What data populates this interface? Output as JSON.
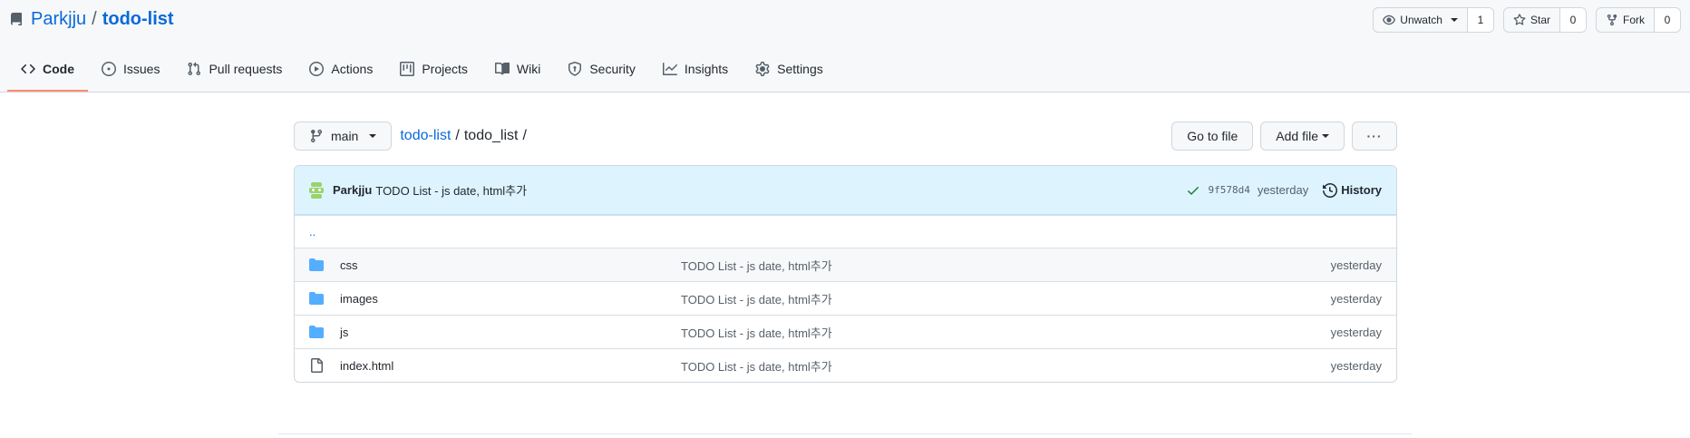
{
  "repo": {
    "owner": "Parkjju",
    "separator": "/",
    "name": "todo-list"
  },
  "buttons": {
    "watch": {
      "label": "Unwatch",
      "count": "1"
    },
    "star": {
      "label": "Star",
      "count": "0"
    },
    "fork": {
      "label": "Fork",
      "count": "0"
    }
  },
  "tabs": [
    {
      "label": "Code",
      "icon": "code-icon",
      "active": true
    },
    {
      "label": "Issues",
      "icon": "issue-icon"
    },
    {
      "label": "Pull requests",
      "icon": "pull-request-icon"
    },
    {
      "label": "Actions",
      "icon": "play-icon"
    },
    {
      "label": "Projects",
      "icon": "project-icon"
    },
    {
      "label": "Wiki",
      "icon": "book-icon"
    },
    {
      "label": "Security",
      "icon": "shield-icon"
    },
    {
      "label": "Insights",
      "icon": "graph-icon"
    },
    {
      "label": "Settings",
      "icon": "gear-icon"
    }
  ],
  "nav": {
    "branch": "main",
    "breadcrumb": {
      "repo": "todo-list",
      "sep1": "/",
      "dir": "todo_list",
      "sep2": "/"
    },
    "go_to_file": "Go to file",
    "add_file": "Add file",
    "more": "···"
  },
  "commit": {
    "author": "Parkjju",
    "message": "TODO List - js date, html추가",
    "sha": "9f578d4",
    "age": "yesterday",
    "history": "History"
  },
  "up_dir": "..",
  "files": [
    {
      "type": "folder",
      "name": "css",
      "message": "TODO List - js date, html추가",
      "age": "yesterday"
    },
    {
      "type": "folder",
      "name": "images",
      "message": "TODO List - js date, html추가",
      "age": "yesterday"
    },
    {
      "type": "folder",
      "name": "js",
      "message": "TODO List - js date, html추가",
      "age": "yesterday"
    },
    {
      "type": "file",
      "name": "index.html",
      "message": "TODO List - js date, html추가",
      "age": "yesterday"
    }
  ],
  "colors": {
    "accent": "#0969da",
    "active_tab_underline": "#fd8c73",
    "folder": "#54aeff",
    "commit_bg": "#ddf4ff",
    "check": "#1a7f37"
  }
}
